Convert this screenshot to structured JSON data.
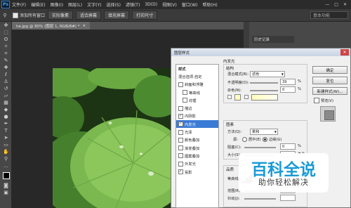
{
  "app": {
    "logo_text": "Ps"
  },
  "menu": [
    "文件(F)",
    "编辑(E)",
    "图像(I)",
    "图层(L)",
    "文字(Y)",
    "选择(S)",
    "滤镜(T)",
    "3D(D)",
    "视图(V)",
    "窗口(W)",
    "帮助(H)"
  ],
  "window_controls": [
    "—",
    "□",
    "✕"
  ],
  "options_bar": {
    "sample_all_label": "添加所有窗口",
    "buttons": [
      "实际像素",
      "适合屏幕",
      "填充屏幕",
      "打印尺寸"
    ],
    "workspace": "基本功能"
  },
  "document": {
    "tab_label": "he.jpg @ 80% (图层 1, RGB/8#) *"
  },
  "panels": {
    "history_tab": "历史记录"
  },
  "dialog": {
    "title": "图层样式",
    "styles_header": "样式",
    "blend_options": "混合选项:自定",
    "style_items": [
      {
        "label": "斜面和浮雕",
        "checked": false
      },
      {
        "label": "等高线",
        "checked": false
      },
      {
        "label": "纹理",
        "checked": false
      },
      {
        "label": "描边",
        "checked": false
      },
      {
        "label": "内阴影",
        "checked": true
      },
      {
        "label": "内发光",
        "checked": true
      },
      {
        "label": "光泽",
        "checked": false
      },
      {
        "label": "颜色叠加",
        "checked": false
      },
      {
        "label": "渐变叠加",
        "checked": false
      },
      {
        "label": "图案叠加",
        "checked": false
      },
      {
        "label": "外发光",
        "checked": false
      },
      {
        "label": "投影",
        "checked": true
      }
    ],
    "section_title": "内发光",
    "structure": {
      "title": "结构",
      "blend_mode_label": "混合模式(B):",
      "blend_mode_value": "滤色",
      "opacity_label": "不透明度(O):",
      "opacity_value": "39",
      "opacity_unit": "%",
      "noise_label": "杂色(N):",
      "noise_value": "0",
      "noise_unit": "%"
    },
    "elements": {
      "title": "图素",
      "method_label": "方法(Q):",
      "method_value": "柔和",
      "source_label": "源:",
      "source_center": "居中(E)",
      "source_edge": "边缘(G)",
      "choke_label": "阻塞(C):",
      "choke_value": "0",
      "choke_unit": "%",
      "size_label": "大小(S):",
      "size_unit": "像素"
    },
    "quality": {
      "title": "品质",
      "contour_label": "等高线:",
      "range_label": "范围(R):",
      "jitter_label": "抖动(J):"
    },
    "buttons": {
      "ok": "确定",
      "cancel": "复位",
      "new_style": "新建样式(W)...",
      "preview": "预览(V)"
    },
    "colors": {
      "glow": "#ffffbe",
      "selected": "#3a7bd5"
    }
  },
  "watermark": {
    "title": "百科全说",
    "subtitle": "助你轻松解决"
  }
}
